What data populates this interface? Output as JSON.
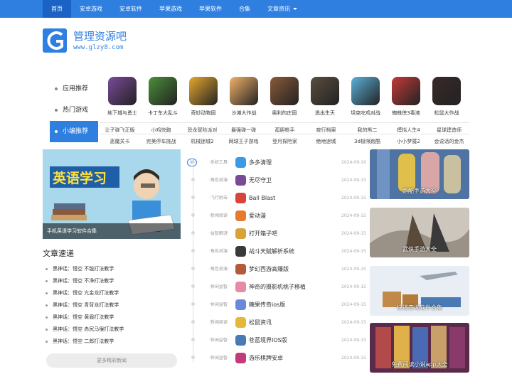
{
  "topnav": {
    "items": [
      {
        "label": "首页",
        "active": true
      },
      {
        "label": "安卓游戏"
      },
      {
        "label": "安卓软件"
      },
      {
        "label": "苹果游戏"
      },
      {
        "label": "苹果软件"
      },
      {
        "label": "合集"
      },
      {
        "label": "文章资讯"
      }
    ]
  },
  "logo": {
    "name": "管理资源吧",
    "url": "www.glzy8.com",
    "color": "#2f7fe0"
  },
  "category_tabs": [
    {
      "label": "应用推荐"
    },
    {
      "label": "热门游戏"
    },
    {
      "label": "小编推荐",
      "active": true
    }
  ],
  "featured_apps": [
    {
      "name": "地下城与勇士",
      "color": "#7a4a9a"
    },
    {
      "name": "卡丁车大乱斗",
      "color": "#4a8f3a"
    },
    {
      "name": "奇妙动物园",
      "color": "#e6a82e"
    },
    {
      "name": "沙滩大作战",
      "color": "#f2b36a"
    },
    {
      "name": "奥利的庄园",
      "color": "#8a5a3a"
    },
    {
      "name": "逃出生天",
      "color": "#5a4e3e"
    },
    {
      "name": "坦克吃鸡对战",
      "color": "#5bb1d9"
    },
    {
      "name": "蜘蛛侠3毒液",
      "color": "#c43a3a"
    },
    {
      "name": "松鼠大作战",
      "color": "#3a2a2a"
    }
  ],
  "game_links": [
    [
      "让子弹飞正版",
      "小鸡快跑",
      "恐龙冒险派对",
      "最强弹一弹",
      "孤胆枪手",
      "夜行档案",
      "我的熊二",
      "模拟人生4",
      "星球建造师"
    ],
    [
      "恶魔关卡",
      "完美停车挑战",
      "机械迷城2",
      "网球王子游戏",
      "登月探险家",
      "绝地迷城",
      "3d极限跑酷",
      "小小梦魇2",
      "会说话的金杰"
    ]
  ],
  "banner": {
    "title": "英语学习",
    "caption": "手机英语学习软件合集"
  },
  "news": {
    "heading": "文章速递",
    "items": [
      "黑神话：悟空 不能打法教学",
      "黑神话：悟空 不净打法教学",
      "黑神话：悟空 亢金龙打法教学",
      "黑神话：悟空 青背龙打法教学",
      "黑神话：悟空 黄眉打法教学",
      "黑神话：悟空 赤尻马猴打法教学",
      "黑神话：悟空 二郎打法教学"
    ],
    "more_label": "更多精彩新闻"
  },
  "timeline": {
    "new_label": "新",
    "items": [
      {
        "cat": "·系统工具·",
        "name": "多多清理",
        "date": "2024-09-16",
        "color": "#3a9ae6"
      },
      {
        "cat": "·角色扮演·",
        "name": "无尽守卫",
        "date": "2024-09-15",
        "color": "#7a4a9a"
      },
      {
        "cat": "·飞行射击·",
        "name": "Ball Blast",
        "date": "2024-09-15",
        "color": "#d9443a"
      },
      {
        "cat": "·新闻阅读·",
        "name": "爱动漫",
        "date": "2024-09-15",
        "color": "#e67a2e"
      },
      {
        "cat": "·益智解谜·",
        "name": "打开箱子吧",
        "date": "2024-09-15",
        "color": "#d9a13a"
      },
      {
        "cat": "·角色扮演·",
        "name": "战斗天赋解析系统",
        "date": "2024-09-15",
        "color": "#3a3a3a"
      },
      {
        "cat": "·角色扮演·",
        "name": "梦幻西游高爆版",
        "date": "2024-09-15",
        "color": "#b35a3a"
      },
      {
        "cat": "·休闲益智·",
        "name": "神奇的摄影机桃子移植",
        "date": "2024-09-15",
        "color": "#e68aa6"
      },
      {
        "cat": "·休闲益智·",
        "name": "糖果传奇ios版",
        "date": "2024-09-15",
        "color": "#6a8ad9"
      },
      {
        "cat": "·新闻阅读·",
        "name": "松鼠资讯",
        "date": "2024-09-15",
        "color": "#e6b83a"
      },
      {
        "cat": "·休闲益智·",
        "name": "苍蓝境界IOS版",
        "date": "2024-09-15",
        "color": "#4a7ab3"
      },
      {
        "cat": "·休闲益智·",
        "name": "游乐棋牌安卓",
        "date": "2024-09-15",
        "color": "#c43a7a"
      }
    ]
  },
  "cards": [
    {
      "caption": "跑酷手游大全",
      "color": "#5d7fa8"
    },
    {
      "caption": "武侠手游大全",
      "color": "#8a8478"
    },
    {
      "caption": "快递查询软件合集",
      "color": "#c9d7e6"
    },
    {
      "caption": "免费阅读小说app大全",
      "color": "#6a3a5a"
    }
  ]
}
